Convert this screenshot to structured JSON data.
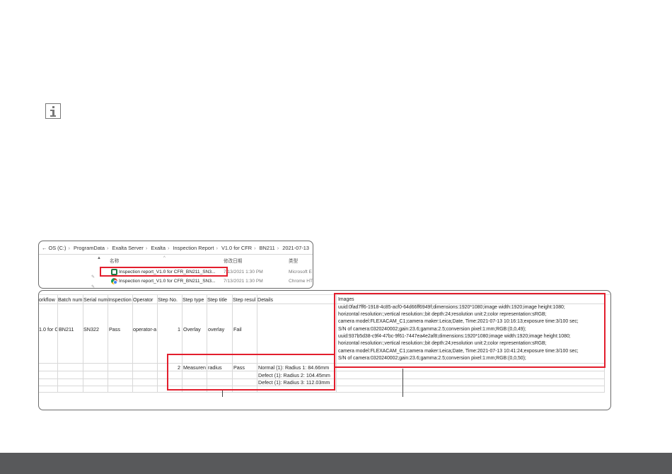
{
  "explorer": {
    "path": [
      "OS (C:)",
      "ProgramData",
      "Exalta Server",
      "Exalta",
      "Inspection Report",
      "V1.0 for CFR",
      "BN211",
      "2021-07-13"
    ],
    "back_glyph": "←",
    "separator": "›",
    "columns": {
      "name": "名称",
      "date": "修改日期",
      "type": "类型"
    },
    "files": [
      {
        "name": "Inspection report_V1.0 for CFR_BN211_SN3...",
        "date": "7/13/2021 1:30 PM",
        "type": "Microsoft E",
        "icon": "excel-icon"
      },
      {
        "name": "Inspection report_V1.0 for CFR_BN211_SN3...",
        "date": "7/13/2021 1:30 PM",
        "type": "Chrome HT",
        "icon": "chrome-icon"
      }
    ]
  },
  "sheet": {
    "headers": [
      "orkflow",
      "Batch num",
      "Serial num",
      "Inspection",
      "Operator",
      "Step No.",
      "Step type",
      "Step title",
      "Step resul",
      "Details"
    ],
    "row1": [
      "1.0 for C",
      "BN211",
      "SN322",
      "Pass",
      "operator-a",
      "1",
      "Overlay",
      "overlay",
      "Fail"
    ],
    "row2": {
      "step_no": "2",
      "step_type": "Measuren",
      "step_title": "radius",
      "step_result": "Pass"
    },
    "details": [
      "Normal (1): Radius 1: 84.66mm",
      "Defect (1): Radius 2: 104.45mm",
      "Defect (1): Radius 3: 112.03mm"
    ],
    "images_header": "Images",
    "images_lines": [
      "uuid:0fad7ff6-1918-4c85-acf0-64d66ff6949f;dimensions:1920*1080;image width:1920;image height:1080;",
      "horizontal resolution:;vertical resolution:;bit depth:24;resolution unit:2;color representation:sRGB;",
      "camera model:FLEXACAM_C1;camera maker:Leica;Date, Time:2021-07-13 10:16:13;exposure time:3/100 sec;",
      "S/N of camera:0320240002;gain:23.6;gamma:2.5;conversion pixel:1:mm;RGB:(0,0,49);",
      "uuid:937b5d38-c9f4-47bc-9f61-7447ea4e2af8;dimensions:1920*1080;image width:1920;image height:1080;",
      "horizontal resolution:;vertical resolution:;bit depth:24;resolution unit:2;color representation:sRGB;",
      "camera model:FLEXACAM_C1;camera maker:Leica;Date, Time:2021-07-13 10:41:24;exposure time:3/100 sec;",
      "S/N of camera:0320240002;gain:23.6;gamma:2.5;conversion pixel:1:mm;RGB:(0,0,50);"
    ]
  },
  "colors": {
    "highlight": "#e31e2d",
    "footer": "#58595b",
    "panel_border": "#6b6b6b"
  }
}
